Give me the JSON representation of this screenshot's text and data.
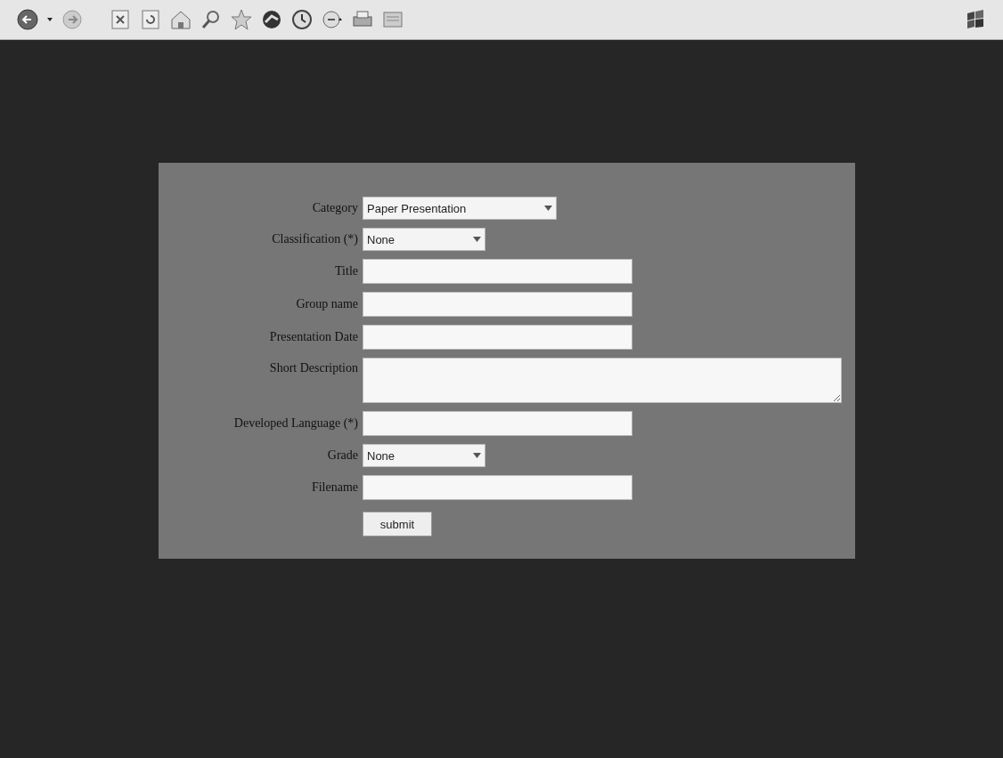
{
  "form": {
    "fields": [
      {
        "kind": "select",
        "label": "Category",
        "value": "Paper Presentation"
      },
      {
        "kind": "select",
        "label": "Classification (*)",
        "value": "None"
      },
      {
        "kind": "text",
        "label": "Title"
      },
      {
        "kind": "text",
        "label": "Group name"
      },
      {
        "kind": "text",
        "label": "Presentation Date"
      },
      {
        "kind": "textarea",
        "label": "Short Description"
      },
      {
        "kind": "text",
        "label": "Developed Language (*)"
      },
      {
        "kind": "select",
        "label": "Grade",
        "value": "None"
      },
      {
        "kind": "text",
        "label": "Filename"
      }
    ],
    "submit": "submit"
  }
}
